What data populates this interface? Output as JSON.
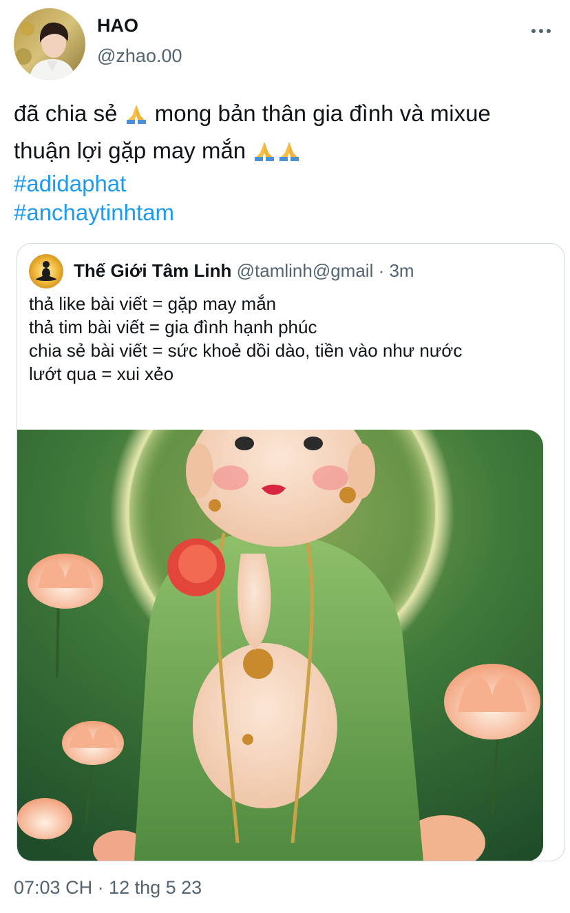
{
  "author": {
    "display_name": "HAO",
    "handle": "@zhao.00"
  },
  "tweet": {
    "line1_part1": "đã chia sẻ",
    "line1_part2": "mong bản thân gia đình và mixue",
    "line2": "thuận lợi gặp may mắn",
    "emoji": "🙏",
    "hashtags": [
      "#adidaphat",
      "#anchaytinhtam"
    ]
  },
  "quote": {
    "name": "Thế Giới Tâm Linh",
    "handle": "@tamlinh@gmail",
    "separator": " · ",
    "time": "3m",
    "lines": [
      "thả like bài viết = gặp may mắn",
      "thả tim bài viết = gia đình hạnh phúc",
      "chia sẻ bài viết = sức khoẻ dồi dào, tiền vào như nước",
      "lướt qua = xui xẻo"
    ]
  },
  "timestamp": "07:03 CH · 12 thg 5 23",
  "icons": {
    "more": "more-horizontal-icon",
    "pray": "folded-hands-icon"
  },
  "colors": {
    "link": "#1d9bf0",
    "secondary_text": "#536471",
    "border": "#cfd9de"
  }
}
